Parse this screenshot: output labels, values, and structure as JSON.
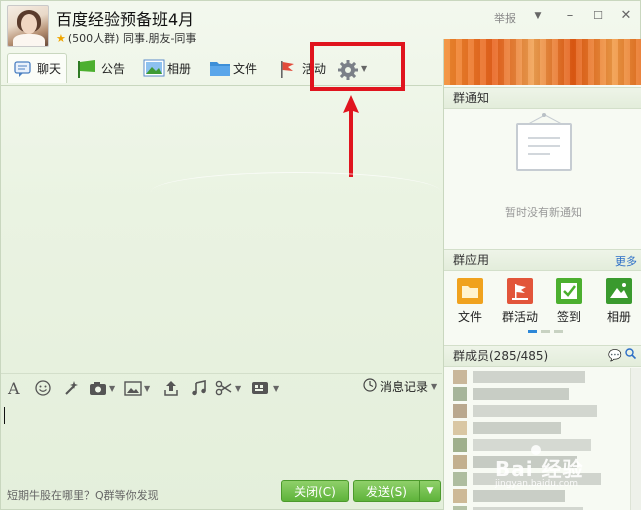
{
  "header": {
    "title": "百度经验预备班4月",
    "subtitle": "(500人群) 同事.朋友-同事",
    "report_label": "举报"
  },
  "toolbar": {
    "items": [
      {
        "label": "聊天",
        "icon": "chat-bubble-icon"
      },
      {
        "label": "公告",
        "icon": "megaphone-icon"
      },
      {
        "label": "相册",
        "icon": "photo-icon"
      },
      {
        "label": "文件",
        "icon": "folder-icon"
      },
      {
        "label": "活动",
        "icon": "flag-icon"
      },
      {
        "label": "",
        "icon": "gear-icon"
      }
    ]
  },
  "input_toolbar": {
    "history_label": "消息记录"
  },
  "bottom": {
    "tip": "短期牛股在哪里？Q群等你发现",
    "close_label": "关闭(C)",
    "send_label": "发送(S)"
  },
  "right_panel": {
    "notice_title": "群通知",
    "notice_empty": "暂时没有新通知",
    "apps_title": "群应用",
    "apps_more": "更多",
    "apps": [
      {
        "label": "文件",
        "icon": "folder-app-icon",
        "color": "#f0a21e"
      },
      {
        "label": "群活动",
        "icon": "activity-app-icon",
        "color": "#e2553a"
      },
      {
        "label": "签到",
        "icon": "checkin-app-icon",
        "color": "#4caf2f"
      },
      {
        "label": "相册",
        "icon": "album-app-icon",
        "color": "#3a9a2e"
      }
    ],
    "members_title": "群成员(285/485)"
  },
  "watermark": {
    "text": "Bai 经验",
    "sub": "jingyan.baidu.com"
  },
  "colors": {
    "highlight": "#e0141e",
    "send_button": "#5eb33a",
    "link": "#2d6fc7"
  }
}
